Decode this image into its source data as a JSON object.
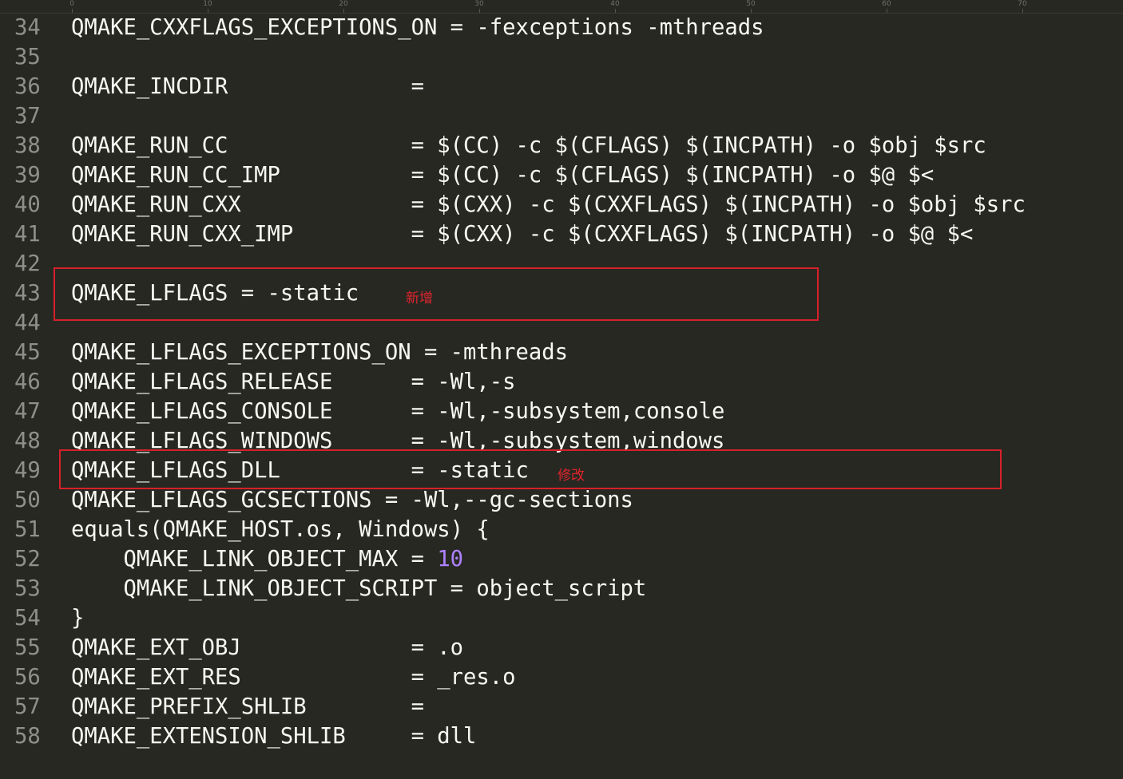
{
  "ruler": {
    "marks": [
      "0",
      "10",
      "20",
      "30",
      "40",
      "50",
      "60",
      "70"
    ]
  },
  "lines": [
    {
      "n": "34",
      "text": "QMAKE_CXXFLAGS_EXCEPTIONS_ON = -fexceptions -mthreads"
    },
    {
      "n": "35",
      "text": ""
    },
    {
      "n": "36",
      "text": "QMAKE_INCDIR              ="
    },
    {
      "n": "37",
      "text": ""
    },
    {
      "n": "38",
      "text": "QMAKE_RUN_CC              = $(CC) -c $(CFLAGS) $(INCPATH) -o $obj $src"
    },
    {
      "n": "39",
      "text": "QMAKE_RUN_CC_IMP          = $(CC) -c $(CFLAGS) $(INCPATH) -o $@ $<"
    },
    {
      "n": "40",
      "text": "QMAKE_RUN_CXX             = $(CXX) -c $(CXXFLAGS) $(INCPATH) -o $obj $src"
    },
    {
      "n": "41",
      "text": "QMAKE_RUN_CXX_IMP         = $(CXX) -c $(CXXFLAGS) $(INCPATH) -o $@ $<"
    },
    {
      "n": "42",
      "text": ""
    },
    {
      "n": "43",
      "text": "QMAKE_LFLAGS = -static"
    },
    {
      "n": "44",
      "text": ""
    },
    {
      "n": "45",
      "text": "QMAKE_LFLAGS_EXCEPTIONS_ON = -mthreads"
    },
    {
      "n": "46",
      "text": "QMAKE_LFLAGS_RELEASE      = -Wl,-s"
    },
    {
      "n": "47",
      "text": "QMAKE_LFLAGS_CONSOLE      = -Wl,-subsystem,console"
    },
    {
      "n": "48",
      "text": "QMAKE_LFLAGS_WINDOWS      = -Wl,-subsystem,windows"
    },
    {
      "n": "49",
      "text": "QMAKE_LFLAGS_DLL          = -static"
    },
    {
      "n": "50",
      "text": "QMAKE_LFLAGS_GCSECTIONS = -Wl,--gc-sections"
    },
    {
      "n": "51",
      "text": "equals(QMAKE_HOST.os, Windows) {"
    },
    {
      "n": "52",
      "text": "    QMAKE_LINK_OBJECT_MAX = ",
      "num": "10"
    },
    {
      "n": "53",
      "text": "    QMAKE_LINK_OBJECT_SCRIPT = object_script"
    },
    {
      "n": "54",
      "text": "}"
    },
    {
      "n": "55",
      "text": "QMAKE_EXT_OBJ             = .o"
    },
    {
      "n": "56",
      "text": "QMAKE_EXT_RES             = _res.o"
    },
    {
      "n": "57",
      "text": "QMAKE_PREFIX_SHLIB        ="
    },
    {
      "n": "58",
      "text": "QMAKE_EXTENSION_SHLIB     = dll"
    }
  ],
  "annotations": {
    "added_label": "新增",
    "modified_label": "修改"
  },
  "colors": {
    "background": "#272822",
    "text": "#f8f8f2",
    "line_number": "#8f908a",
    "number": "#ae81ff",
    "annotation": "#d8202a"
  }
}
